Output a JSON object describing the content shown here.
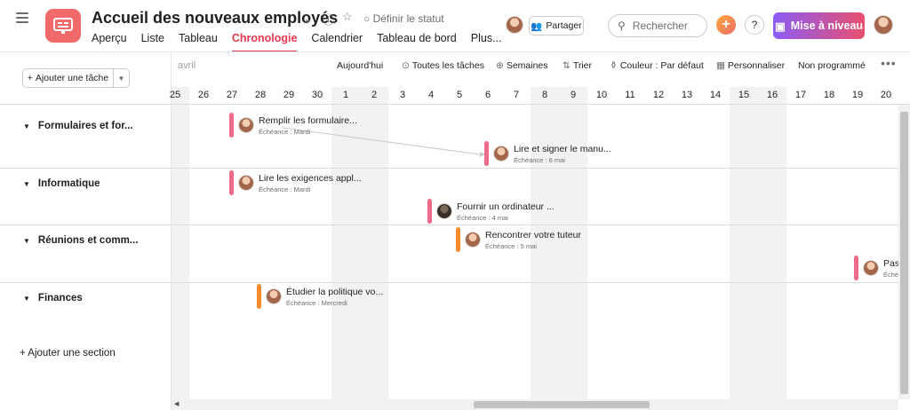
{
  "header": {
    "title": "Accueil des nouveaux employés",
    "status_label": "Définir le statut",
    "share_label": "Partager",
    "search_placeholder": "Rechercher",
    "upgrade_label": "Mise à niveau",
    "help_label": "?"
  },
  "tabs": [
    {
      "label": "Aperçu"
    },
    {
      "label": "Liste"
    },
    {
      "label": "Tableau"
    },
    {
      "label": "Chronologie"
    },
    {
      "label": "Calendrier"
    },
    {
      "label": "Tableau de bord"
    },
    {
      "label": "Plus..."
    }
  ],
  "toolbar": {
    "add_task_label": "Ajouter une tâche",
    "month_label": "avril",
    "today": "Aujourd'hui",
    "all_tasks": "Toutes les tâches",
    "weeks": "Semaines",
    "sort": "Trier",
    "color": "Couleur : Par défaut",
    "customize": "Personnaliser",
    "unscheduled": "Non programmé"
  },
  "dates": [
    "25",
    "26",
    "27",
    "28",
    "29",
    "30",
    "1",
    "2",
    "3",
    "4",
    "5",
    "6",
    "7",
    "8",
    "9",
    "10",
    "11",
    "12",
    "13",
    "14",
    "15",
    "16",
    "17",
    "18",
    "19",
    "20"
  ],
  "sections": [
    {
      "name": "Formulaires et for..."
    },
    {
      "name": "Informatique"
    },
    {
      "name": "Réunions et comm..."
    },
    {
      "name": "Finances"
    }
  ],
  "add_section_label": "+ Ajouter une section",
  "tasks": [
    {
      "name": "Remplir les formulaire...",
      "due": "Échéance : Mardi",
      "color": "#f06a8a"
    },
    {
      "name": "Lire et signer le manu...",
      "due": "Échéance : 6 mai",
      "color": "#f06a8a"
    },
    {
      "name": "Lire les exigences appl...",
      "due": "Échéance : Mardi",
      "color": "#f06a8a"
    },
    {
      "name": "Fournir un ordinateur ...",
      "due": "Échéance : 4 mai",
      "color": "#f06a8a"
    },
    {
      "name": "Rencontrer votre tuteur",
      "due": "Échéance : 5 mai",
      "color": "#fa8c2b"
    },
    {
      "name": "Pass",
      "due": "Éché",
      "color": "#f06a8a"
    },
    {
      "name": "Étudier la politique vo...",
      "due": "Échéance : Mercredi",
      "color": "#fa8c2b"
    }
  ]
}
